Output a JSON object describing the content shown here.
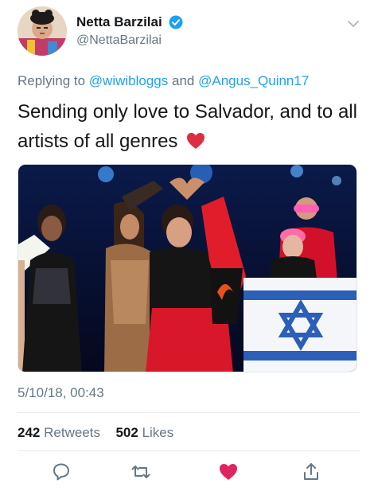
{
  "tweet": {
    "display_name": "Netta Barzilai",
    "handle": "@NettaBarzilai",
    "replying_prefix": "Replying to",
    "replying_to": [
      "@wiwibloggs",
      "@Angus_Quinn17"
    ],
    "replying_joiner": "and",
    "text_line1": "Sending only love to Salvador, and to all",
    "text_line2": "artists of all genres",
    "text_emoji": "heart-emoji",
    "timestamp": "5/10/18, 00:43",
    "retweets_count": "242",
    "retweets_label": "Retweets",
    "likes_count": "502",
    "likes_label": "Likes",
    "liked": true
  },
  "icons": {
    "verified": "verified-badge-icon",
    "menu": "chevron-down-icon",
    "reply": "reply-icon",
    "retweet": "retweet-icon",
    "like": "heart-icon",
    "share": "share-icon"
  },
  "colors": {
    "link": "#1da1f2",
    "secondary_text": "#657786",
    "like_active": "#e0245e",
    "verified": "#1da1f2"
  }
}
